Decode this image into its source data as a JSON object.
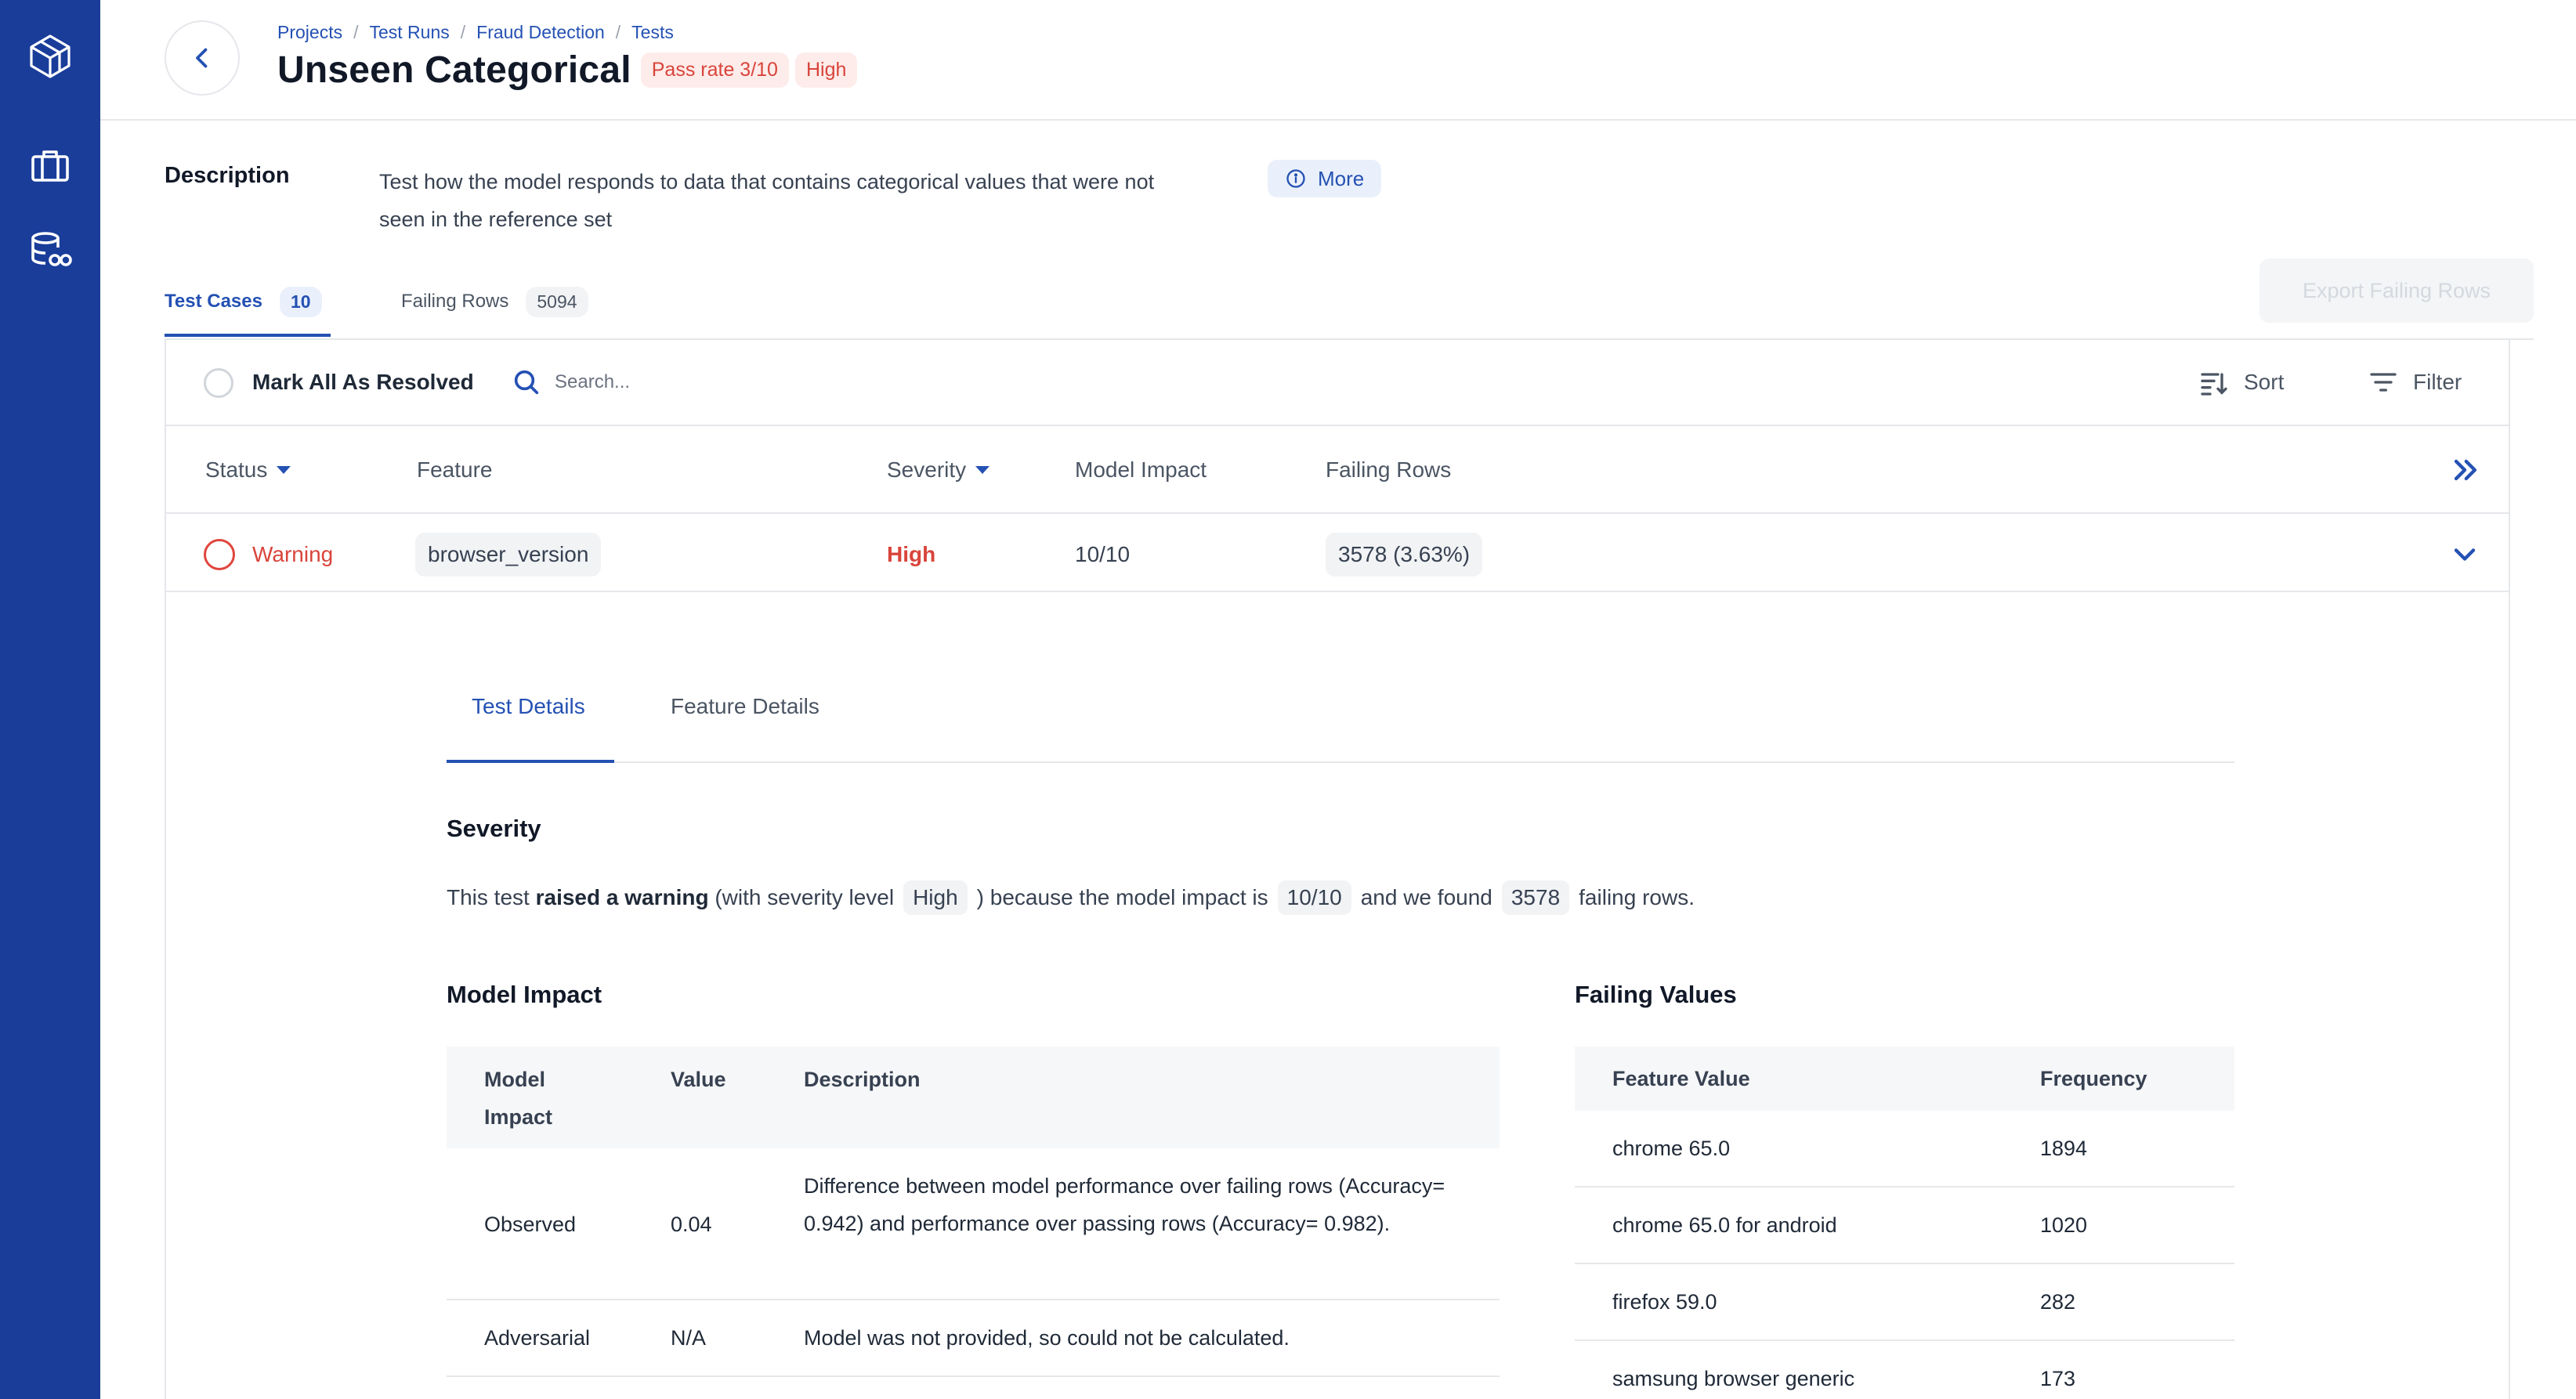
{
  "sidebar": {
    "items": [
      {
        "icon": "cube-logo-icon"
      },
      {
        "icon": "briefcase-icon"
      },
      {
        "icon": "database-link-icon"
      }
    ]
  },
  "header": {
    "breadcrumb": [
      "Projects",
      "Test Runs",
      "Fraud Detection",
      "Tests"
    ],
    "title": "Unseen Categorical",
    "pass_rate": "Pass rate 3/10",
    "severity": "High"
  },
  "description": {
    "heading": "Description",
    "text": "Test how the model responds to data that contains categorical values that were not seen in the reference set",
    "more_label": "More"
  },
  "tabs": [
    {
      "label": "Test Cases",
      "count": "10"
    },
    {
      "label": "Failing Rows",
      "count": "5094"
    }
  ],
  "export_label": "Export Failing Rows",
  "toolbar": {
    "mark_all_label": "Mark All As Resolved",
    "search_placeholder": "Search...",
    "sort_label": "Sort",
    "filter_label": "Filter"
  },
  "table": {
    "columns": [
      "Status",
      "Feature",
      "Severity",
      "Model Impact",
      "Failing Rows"
    ],
    "rows": [
      {
        "status": "Warning",
        "feature": "browser_version",
        "severity": "High",
        "model_impact": "10/10",
        "failing_rows": "3578 (3.63%)"
      }
    ]
  },
  "details": {
    "tabs": [
      "Test Details",
      "Feature Details"
    ],
    "severity_heading": "Severity",
    "sentence": {
      "p1": "This test",
      "bold": "raised a warning",
      "p2": "(with severity level",
      "level": "High",
      "p3": ") because the model impact is",
      "impact": "10/10",
      "p4": "and we found",
      "rows": "3578",
      "p5": "failing rows."
    },
    "model_impact": {
      "heading": "Model Impact",
      "columns": [
        "Model Impact",
        "Value",
        "Description"
      ],
      "rows": [
        {
          "name": "Observed",
          "value": "0.04",
          "description": "Difference between model performance over failing rows (Accuracy= 0.942) and performance over passing rows (Accuracy= 0.982)."
        },
        {
          "name": "Adversarial",
          "value": "N/A",
          "description": "Model was not provided, so could not be calculated."
        }
      ]
    },
    "failing_values": {
      "heading": "Failing Values",
      "columns": [
        "Feature Value",
        "Frequency"
      ],
      "rows": [
        {
          "value": "chrome 65.0",
          "frequency": "1894"
        },
        {
          "value": "chrome 65.0 for android",
          "frequency": "1020"
        },
        {
          "value": "firefox 59.0",
          "frequency": "282"
        },
        {
          "value": "samsung browser generic",
          "frequency": "173"
        }
      ]
    }
  },
  "colors": {
    "sidebar": "#1a3d9a",
    "accent": "#2451b3",
    "danger": "#d9443b"
  }
}
